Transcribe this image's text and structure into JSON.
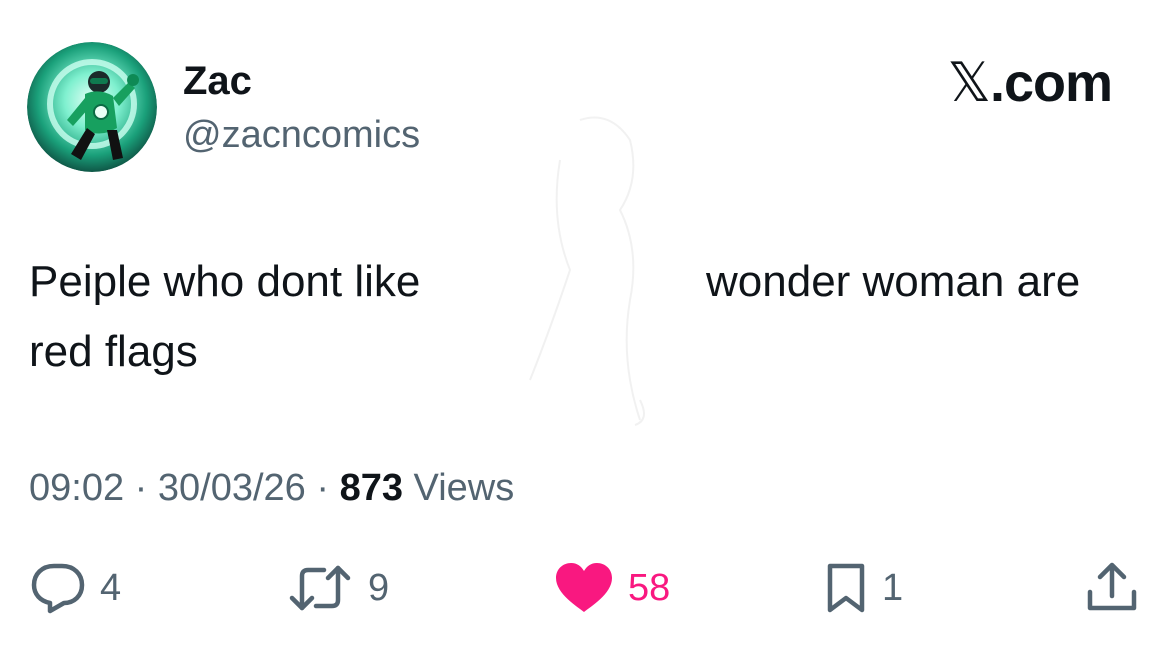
{
  "author": {
    "display_name": "Zac",
    "handle": "@zacncomics"
  },
  "brand": {
    "name": ".com"
  },
  "tweet": {
    "line1_part1": "Peiple who dont like",
    "line1_part2": "wonder woman are",
    "line2": "red flags"
  },
  "meta": {
    "time": "09:02",
    "separator1": " · ",
    "date": "30/03/26",
    "separator2": " · ",
    "views_count": "873",
    "views_label": " Views"
  },
  "actions": {
    "replies": "4",
    "reposts": "9",
    "likes": "58",
    "bookmarks": "1"
  },
  "colors": {
    "text": "#0f1419",
    "secondary": "#536471",
    "like": "#f91880"
  },
  "icons": [
    "avatar-image",
    "x-logo-icon",
    "reply-icon",
    "repost-icon",
    "heart-icon",
    "bookmark-icon",
    "share-icon"
  ]
}
